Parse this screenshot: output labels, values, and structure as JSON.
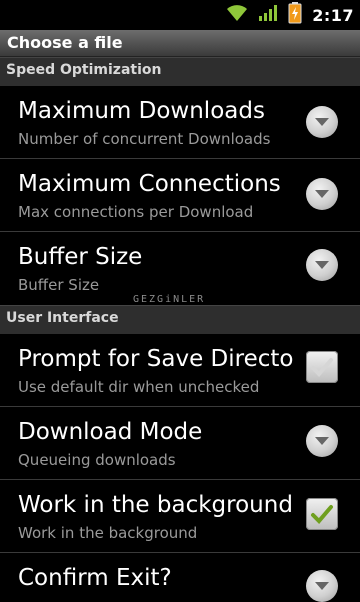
{
  "status_bar": {
    "time": "2:17",
    "icons": [
      "wifi-icon",
      "signal-icon",
      "battery-charging-icon"
    ]
  },
  "title_bar": {
    "title": "Choose a file"
  },
  "sections": [
    {
      "label": "Speed Optimization",
      "items": [
        {
          "title": "Maximum Downloads",
          "summary": "Number of concurrent Downloads",
          "widget": "dropdown"
        },
        {
          "title": "Maximum Connections",
          "summary": "Max connections per Download",
          "widget": "dropdown"
        },
        {
          "title": "Buffer Size",
          "summary": "Buffer Size",
          "widget": "dropdown"
        }
      ]
    },
    {
      "label": "User Interface",
      "items": [
        {
          "title": "Prompt for Save Directory",
          "summary": "Use default dir when unchecked",
          "widget": "checkbox",
          "checked": false
        },
        {
          "title": "Download Mode",
          "summary": "Queueing downloads",
          "widget": "dropdown"
        },
        {
          "title": "Work in the background",
          "summary": "Work in the background",
          "widget": "checkbox",
          "checked": true
        },
        {
          "title": "Confirm Exit?",
          "summary": "",
          "widget": "dropdown"
        }
      ]
    }
  ],
  "watermark": "GEZGiNLER",
  "colors": {
    "checkmark": "#6f9f1f",
    "section_bg": "#2e2e2e",
    "summary_text": "#9a9a9a"
  }
}
